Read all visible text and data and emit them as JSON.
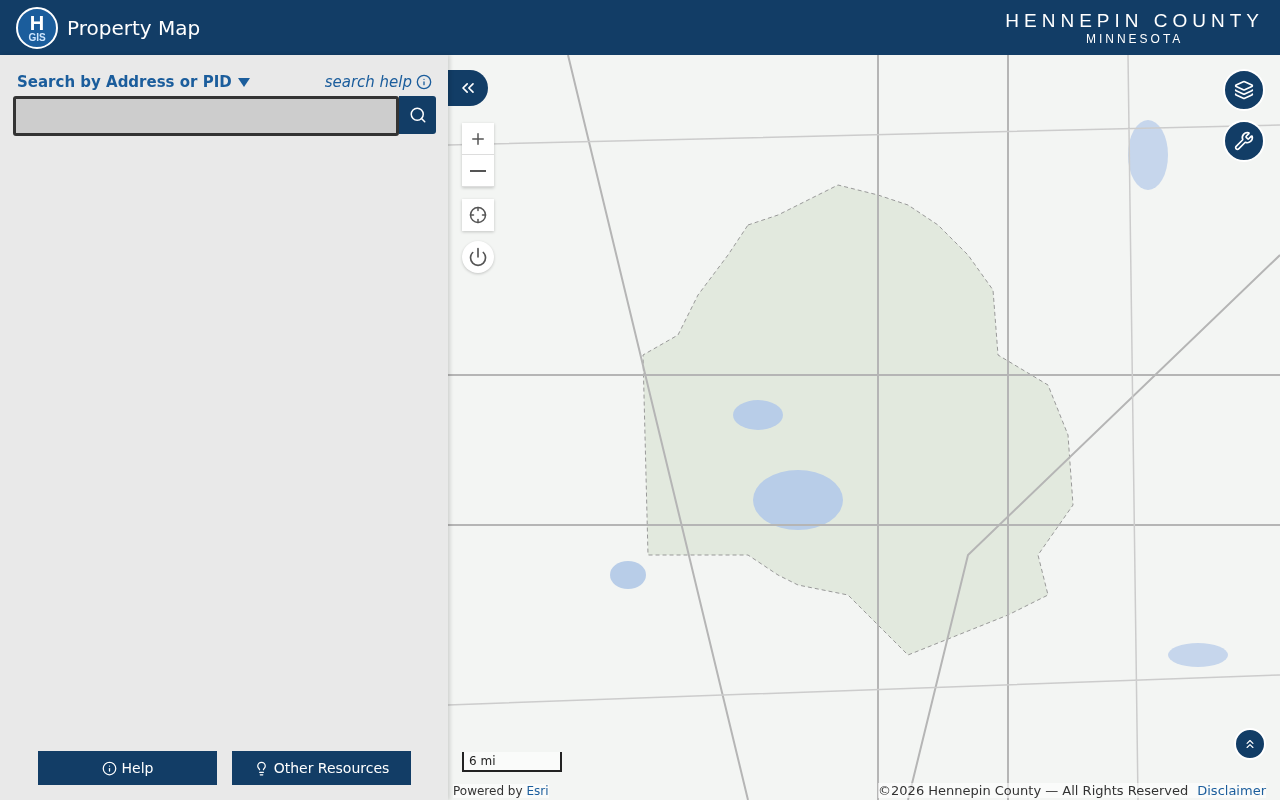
{
  "header": {
    "logo": {
      "letter": "H",
      "text": "GIS"
    },
    "title": "Property Map",
    "brand": {
      "name": "HENNEPIN COUNTY",
      "state": "MINNESOTA"
    }
  },
  "search": {
    "mode_label": "Search by Address or PID",
    "help_link": "search help"
  },
  "sidebar_buttons": [
    {
      "kind": "info",
      "label": "Help"
    },
    {
      "kind": "bulb",
      "label": "Other Resources"
    }
  ],
  "map": {
    "scale": "6 mi",
    "powered_by": "Powered by",
    "powered_link": "Esri",
    "attribution": "©2026 Hennepin County — All Rights Reserved",
    "disclaimer": "Disclaimer"
  }
}
